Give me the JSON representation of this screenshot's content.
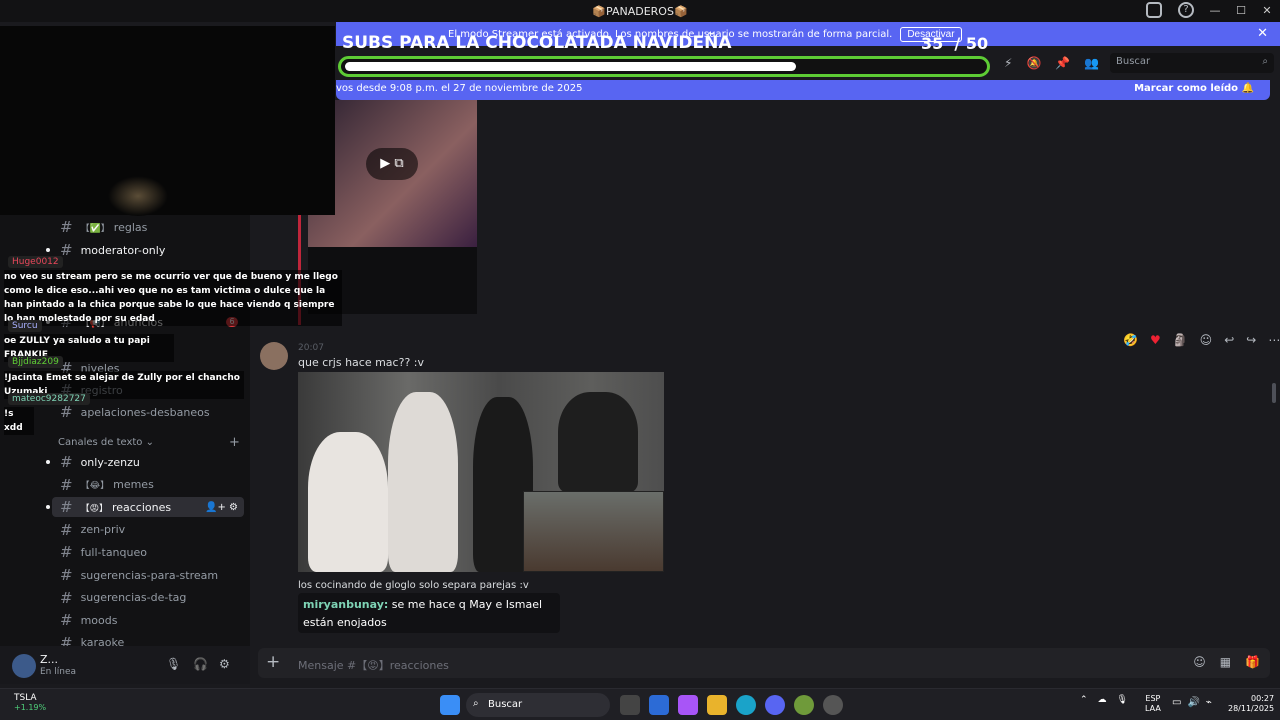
{
  "window": {
    "title": "📦PANADEROS📦",
    "controls": [
      "—",
      "☐",
      "✕"
    ]
  },
  "streamer_banner": {
    "text": "El modo Streamer está activado. Los nombres de usuario se mostrarán de forma parcial.",
    "button": "Desactivar",
    "close": "✕"
  },
  "goal": {
    "title": "SUBS PARA LA CHOCOLATADA NAVIDEÑA",
    "count": "35",
    "total": "/ 50",
    "progress": 0.7
  },
  "search": {
    "placeholder": "Buscar",
    "icon": "search-icon"
  },
  "new_messages": {
    "text": "vos desde 9:08 p.m. el 27 de noviembre de 2025",
    "action": "Marcar como leído"
  },
  "sidebar": {
    "channels": [
      {
        "label": "reglas",
        "emoji": "【✅】",
        "bright": false
      },
      {
        "label": "moderator-only",
        "emoji": "",
        "bright": true
      },
      {
        "label": "anuncios",
        "emoji": "【📢】",
        "bright": true,
        "badge": "6"
      },
      {
        "label": "niveles",
        "emoji": "",
        "bright": false
      },
      {
        "label": "registro",
        "emoji": "",
        "bright": false
      },
      {
        "label": "apelaciones-desbaneos",
        "emoji": "",
        "bright": false
      }
    ],
    "category": "Canales de texto",
    "text_channels": [
      {
        "label": "only-zenzu",
        "emoji": "",
        "bright": true
      },
      {
        "label": "memes",
        "emoji": "【😂】",
        "bright": false
      },
      {
        "label": "reacciones",
        "emoji": "【😡】",
        "bright": true,
        "active": true
      },
      {
        "label": "zen-priv",
        "emoji": "",
        "bright": false
      },
      {
        "label": "full-tanqueo",
        "emoji": "",
        "bright": false
      },
      {
        "label": "sugerencias-para-stream",
        "emoji": "",
        "bright": false
      },
      {
        "label": "sugerencias-de-tag",
        "emoji": "",
        "bright": false
      },
      {
        "label": "moods",
        "emoji": "",
        "bright": false
      },
      {
        "label": "karaoke",
        "emoji": "",
        "bright": false
      }
    ]
  },
  "user": {
    "name": "Z...",
    "status": "En línea"
  },
  "overlay_chat": [
    {
      "name": "Huge0012",
      "text": "no veo su stream pero se me ocurrio ver que de bueno y me llego como le dice eso...ahi veo que no es tam victima o dulce que la han pintado a la chica porque sabe lo que hace viendo q siempre lo han molestado por su edad"
    },
    {
      "name": "Surcu",
      "text": "oe ZULLY ya saludo a tu papi FRANKIE"
    },
    {
      "name": "Bjjdiaz209",
      "text": "!Jacinta Emet se alejar de Zully por el chancho Uzumaki"
    },
    {
      "name": "mateoc9282727",
      "text": "!s xdd"
    }
  ],
  "messages": {
    "m1_time": "20:07",
    "m1_text": "que crjs hace mac?? :v",
    "m2_text": "los cocinando de gloglo solo separa parejas :v",
    "reply_user": "miryanbunay:",
    "reply_text": "se me hace q May e Ismael están enojados"
  },
  "composer": {
    "placeholder": "Mensaje #【😡】reacciones"
  },
  "taskbar": {
    "stock": "TSLA",
    "stock_change": "+1.19%",
    "search": "Buscar",
    "lang1": "ESP",
    "lang2": "LAA",
    "time": "00:27",
    "date": "28/11/2025"
  },
  "colors": {
    "accent": "#5865f2",
    "goal_border": "#5ecc35",
    "active_channel": "#2e2e34"
  }
}
